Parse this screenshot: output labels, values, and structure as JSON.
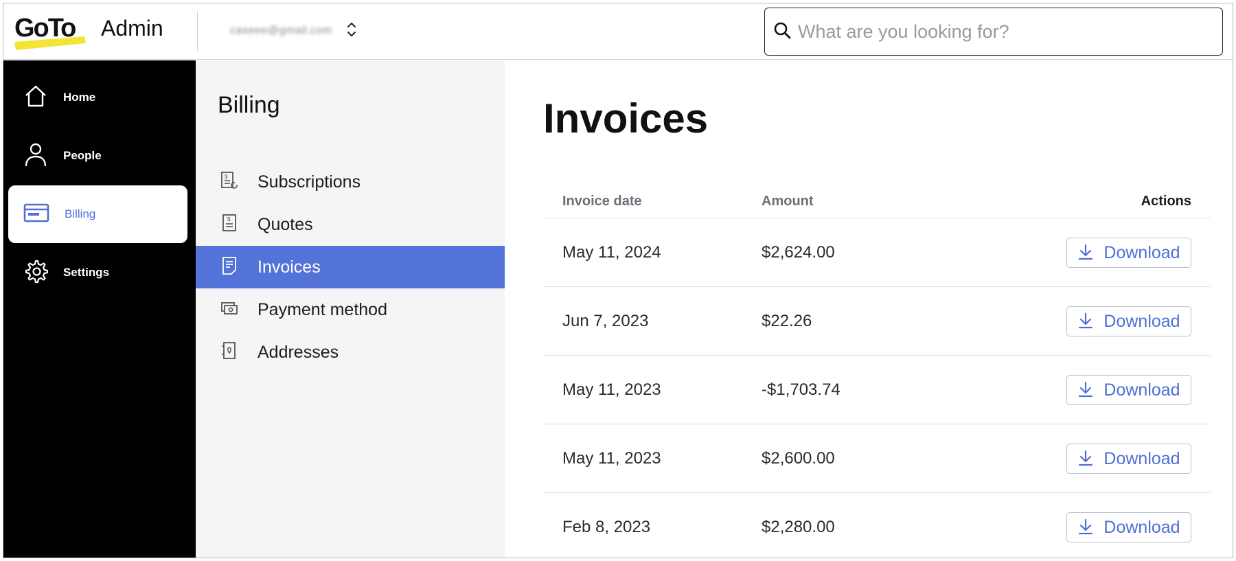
{
  "header": {
    "logo_text": "GoTo",
    "app_label": "Admin",
    "account_name": "caseee@gmail.com",
    "search_placeholder": "What are you looking for?"
  },
  "leftnav": {
    "items": [
      {
        "label": "Home",
        "icon": "home-icon",
        "active": false
      },
      {
        "label": "People",
        "icon": "person-icon",
        "active": false
      },
      {
        "label": "Billing",
        "icon": "billing-card-icon",
        "active": true
      },
      {
        "label": "Settings",
        "icon": "gear-icon",
        "active": false
      }
    ]
  },
  "subnav": {
    "title": "Billing",
    "items": [
      {
        "label": "Subscriptions",
        "icon": "subscriptions-icon",
        "active": false
      },
      {
        "label": "Quotes",
        "icon": "quotes-icon",
        "active": false
      },
      {
        "label": "Invoices",
        "icon": "invoices-icon",
        "active": true
      },
      {
        "label": "Payment method",
        "icon": "payment-method-icon",
        "active": false
      },
      {
        "label": "Addresses",
        "icon": "addresses-icon",
        "active": false
      }
    ]
  },
  "main": {
    "title": "Invoices",
    "columns": {
      "date": "Invoice date",
      "amount": "Amount",
      "actions": "Actions"
    },
    "rows": [
      {
        "date": "May 11, 2024",
        "amount": "$2,624.00",
        "action": "Download"
      },
      {
        "date": "Jun 7, 2023",
        "amount": "$22.26",
        "action": "Download"
      },
      {
        "date": "May 11, 2023",
        "amount": "-$1,703.74",
        "action": "Download"
      },
      {
        "date": "May 11, 2023",
        "amount": "$2,600.00",
        "action": "Download"
      },
      {
        "date": "Feb 8, 2023",
        "amount": "$2,280.00",
        "action": "Download"
      }
    ]
  },
  "colors": {
    "accent": "#4f6fd6",
    "active_subnav": "#5473d8",
    "leftnav_bg": "#000000",
    "subnav_bg": "#f5f5f5",
    "logo_highlight": "#f3e534"
  }
}
